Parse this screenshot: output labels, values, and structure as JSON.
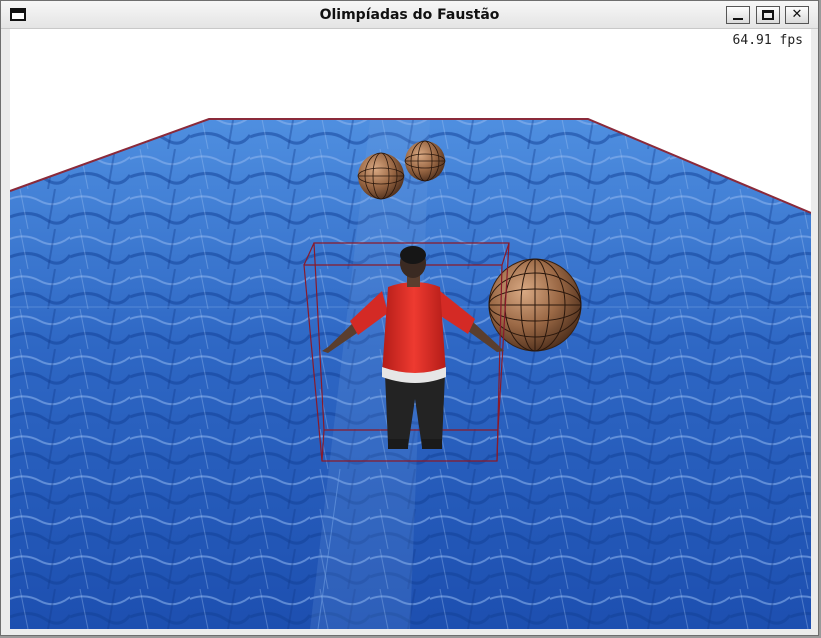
{
  "window": {
    "title": "Olimpíadas do Faustão",
    "menu_icon": "window-menu-icon",
    "minimize_icon": "minimize-icon",
    "maximize_icon": "maximize-icon",
    "close_icon": "close-icon",
    "close_glyph": "✕"
  },
  "hud": {
    "fps": "64.91 fps"
  },
  "scene": {
    "sky_color": "#ffffff",
    "floor_color": "#2f6ac4",
    "floor_edge_color": "#8a2a3a",
    "player_shirt_color": "#e02a25",
    "player_pants_color": "#222222",
    "ball_color": "#9a6845",
    "bounding_box_color": "#8a1a2a"
  }
}
